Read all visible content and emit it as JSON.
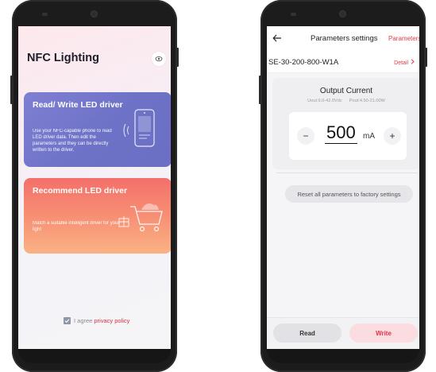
{
  "left_screen": {
    "app_title": "NFC Lighting",
    "settings_icon": "eye-gear-icon",
    "read_write_card": {
      "title": "Read/ Write LED driver",
      "description": "Use your NFC-capable phone to read LED driver data. Then edit the parameters and they can be directly written to the driver.",
      "icon": "nfc-phone-icon"
    },
    "recommend_card": {
      "title": "Recommend LED driver",
      "description": "Match a suitable intelligent driver for your light",
      "icon": "shopping-cart-icon"
    },
    "agreement": {
      "prefix": "I agree",
      "link": "privacy policy",
      "checked": true
    }
  },
  "right_screen": {
    "header": {
      "title": "Parameters settings",
      "action": "Parameters",
      "back_icon": "back-arrow-icon"
    },
    "model": {
      "name": "SE-30-200-800-W1A",
      "detail_label": "Detail"
    },
    "output_current": {
      "title": "Output Current",
      "uout_range": "Uout:9.0-42.0Vdc",
      "pout_range": "Pout:4.50-21.00W",
      "value": "500",
      "unit": "mA",
      "minus_label": "−",
      "plus_label": "+"
    },
    "reset_label": "Reset all parameters to factory settings",
    "read_label": "Read",
    "write_label": "Write"
  },
  "colors": {
    "accent_red": "#e53945",
    "card_purple": "#7276c8",
    "card_coral": "#f6876f"
  }
}
